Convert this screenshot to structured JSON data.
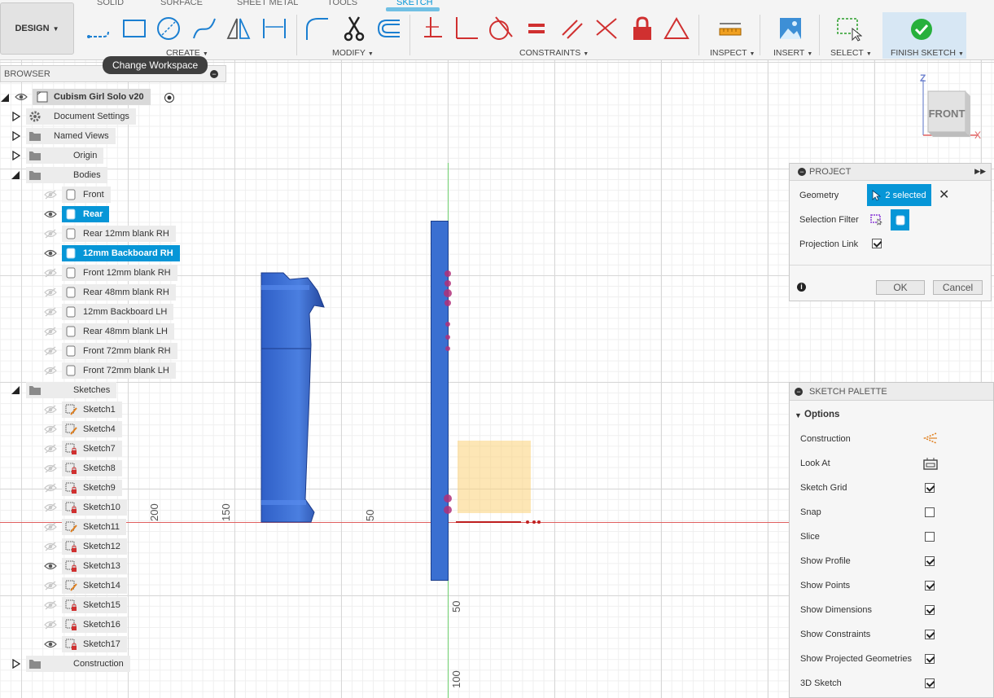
{
  "toolbar": {
    "workspace": "DESIGN",
    "tabs": [
      "SOLID",
      "SURFACE",
      "SHEET METAL",
      "TOOLS",
      "SKETCH"
    ],
    "groups": {
      "create": "CREATE",
      "modify": "MODIFY",
      "constraints": "CONSTRAINTS",
      "inspect": "INSPECT",
      "insert": "INSERT",
      "select": "SELECT",
      "finish": "FINISH SKETCH"
    },
    "tooltip": "Change Workspace",
    "accent": "#0696d7"
  },
  "browser": {
    "title": "BROWSER",
    "root": "Cubism Girl Solo v20",
    "top_nodes": {
      "document_settings": "Document Settings",
      "named_views": "Named Views",
      "origin": "Origin",
      "bodies": "Bodies",
      "sketches": "Sketches",
      "construction": "Construction"
    },
    "bodies": [
      {
        "label": "Front",
        "visible": false,
        "selected": false
      },
      {
        "label": "Rear",
        "visible": true,
        "selected": true
      },
      {
        "label": "Rear 12mm blank RH",
        "visible": false,
        "selected": false
      },
      {
        "label": "12mm Backboard RH",
        "visible": true,
        "selected": true
      },
      {
        "label": "Front 12mm blank RH",
        "visible": false,
        "selected": false
      },
      {
        "label": "Rear 48mm blank RH",
        "visible": false,
        "selected": false
      },
      {
        "label": "12mm Backboard LH",
        "visible": false,
        "selected": false
      },
      {
        "label": "Rear 48mm blank LH",
        "visible": false,
        "selected": false
      },
      {
        "label": "Front  72mm blank RH",
        "visible": false,
        "selected": false
      },
      {
        "label": "Front  72mm blank LH",
        "visible": false,
        "selected": false
      }
    ],
    "sketches": [
      {
        "label": "Sketch1",
        "visible": false,
        "locked": false
      },
      {
        "label": "Sketch4",
        "visible": false,
        "locked": false
      },
      {
        "label": "Sketch7",
        "visible": false,
        "locked": true
      },
      {
        "label": "Sketch8",
        "visible": false,
        "locked": true
      },
      {
        "label": "Sketch9",
        "visible": false,
        "locked": true
      },
      {
        "label": "Sketch10",
        "visible": false,
        "locked": true
      },
      {
        "label": "Sketch11",
        "visible": false,
        "locked": false
      },
      {
        "label": "Sketch12",
        "visible": false,
        "locked": true
      },
      {
        "label": "Sketch13",
        "visible": true,
        "locked": true
      },
      {
        "label": "Sketch14",
        "visible": false,
        "locked": false
      },
      {
        "label": "Sketch15",
        "visible": false,
        "locked": true
      },
      {
        "label": "Sketch16",
        "visible": false,
        "locked": true
      },
      {
        "label": "Sketch17",
        "visible": true,
        "locked": true
      }
    ]
  },
  "canvas": {
    "ruler_labels": {
      "r200": "200",
      "r150": "150",
      "r50a": "50",
      "r50b": "50",
      "r100": "100"
    },
    "viewcube": {
      "face": "FRONT",
      "z": "Z",
      "x": "X"
    }
  },
  "project": {
    "title": "PROJECT",
    "geometry_label": "Geometry",
    "geometry_value": "2 selected",
    "filter_label": "Selection Filter",
    "link_label": "Projection Link",
    "link_checked": true,
    "ok": "OK",
    "cancel": "Cancel"
  },
  "palette": {
    "title": "SKETCH PALETTE",
    "section": "Options",
    "construction": "Construction",
    "look_at": "Look At",
    "options": [
      {
        "label": "Sketch Grid",
        "checked": true
      },
      {
        "label": "Snap",
        "checked": false
      },
      {
        "label": "Slice",
        "checked": false
      },
      {
        "label": "Show Profile",
        "checked": true
      },
      {
        "label": "Show Points",
        "checked": true
      },
      {
        "label": "Show Dimensions",
        "checked": true
      },
      {
        "label": "Show Constraints",
        "checked": true
      },
      {
        "label": "Show Projected Geometries",
        "checked": true
      },
      {
        "label": "3D Sketch",
        "checked": true
      }
    ]
  }
}
